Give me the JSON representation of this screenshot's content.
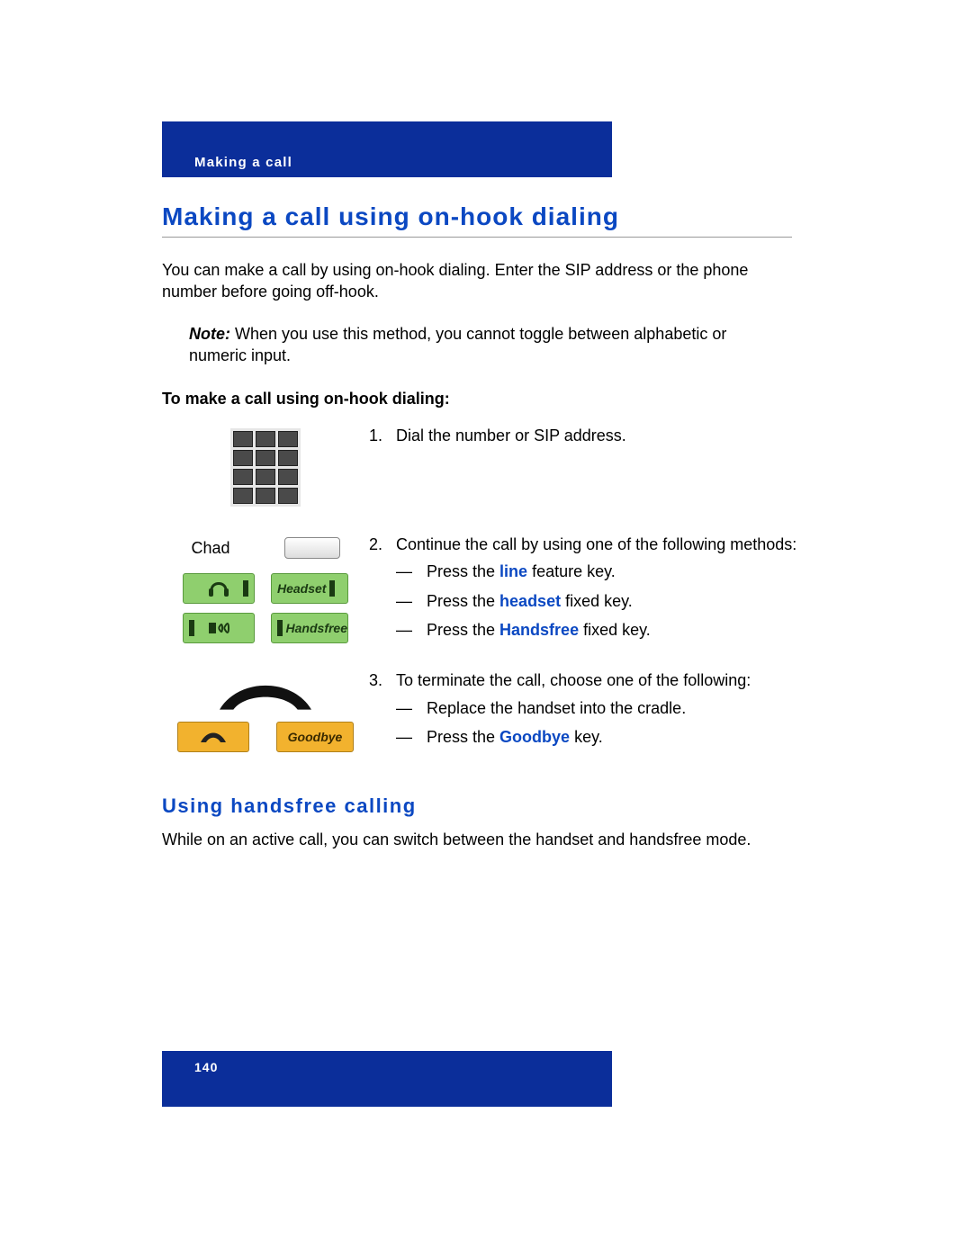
{
  "header": {
    "breadcrumb": "Making a call"
  },
  "title": "Making a call using on-hook dialing",
  "intro": "You can make a call by using on-hook dialing. Enter the SIP address or the phone number before going off-hook.",
  "note": {
    "label": "Note:",
    "text": " When you use this method, you cannot toggle between alphabetic or numeric input."
  },
  "instruction_title": "To make a call using on-hook dialing:",
  "steps": {
    "s1": {
      "num": "1.",
      "text": "Dial the number or SIP address."
    },
    "s2": {
      "num": "2.",
      "lead": "Continue the call by using one of the following methods:",
      "chad": "Chad",
      "headset_label": "Headset",
      "handsfree_label": "Handsfree",
      "items": {
        "a_pre": "Press the ",
        "a_key": "line",
        "a_post": " feature key.",
        "b_pre": "Press the ",
        "b_key": "headset",
        "b_post": " fixed key.",
        "c_pre": "Press the ",
        "c_key": "Handsfree",
        "c_post": " fixed key."
      }
    },
    "s3": {
      "num": "3.",
      "lead": "To terminate the call, choose one of the following:",
      "goodbye_label": "Goodbye",
      "items": {
        "a": "Replace the handset into the cradle.",
        "b_pre": "Press the ",
        "b_key": "Goodbye",
        "b_post": " key."
      }
    }
  },
  "subsection": {
    "title": "Using handsfree calling",
    "text": "While on an active call, you can switch between the handset and handsfree mode."
  },
  "footer": {
    "page": "140"
  },
  "dash": "—"
}
